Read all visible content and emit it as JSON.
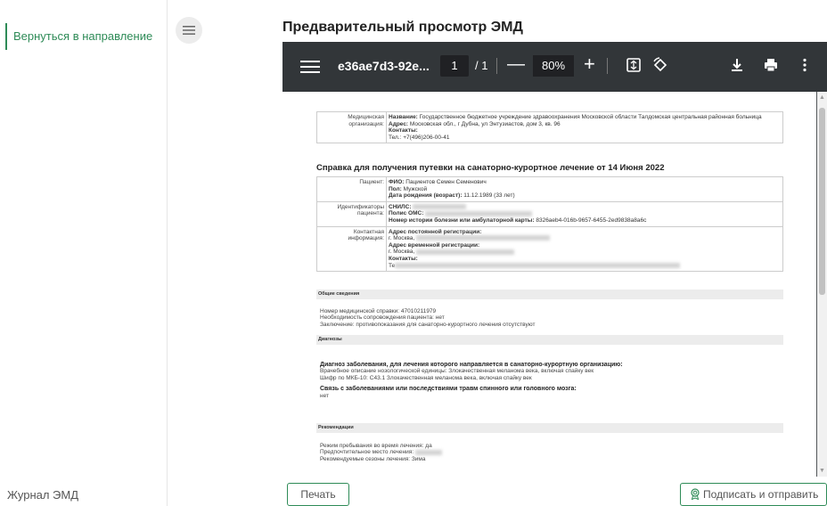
{
  "sidebar": {
    "back_label": "Вернуться в направление",
    "journal_label": "Журнал ЭМД"
  },
  "page": {
    "title": "Предварительный просмотр ЭМД"
  },
  "viewer": {
    "file_name": "e36ae7d3-92e...",
    "current_page": "1",
    "total_pages": "/ 1",
    "zoom": "80%"
  },
  "document": {
    "org": {
      "label": "Медицинская организация:",
      "name_label": "Название:",
      "name_value": "Государственное бюджетное учреждение здравоохранения Московской области Талдомская центральная районная больница",
      "address_label": "Адрес:",
      "address_value": "Московская обл., г Дубна, ул Энтузиастов, дом 3, кв. 96",
      "contacts_label": "Контакты:",
      "phone": "Тел.: +7(496)206-00-41"
    },
    "heading": "Справка для получения путевки на санаторно-курортное лечение от 14 Июня 2022",
    "patient": {
      "label": "Пациент:",
      "fio_label": "ФИО:",
      "fio_value": "Пациентов Семен Семенович",
      "sex_label": "Пол:",
      "sex_value": "Мужской",
      "dob_label": "Дата рождения (возраст):",
      "dob_value": "11.12.1989 (33 лет)"
    },
    "ids": {
      "label": "Идентификаторы пациента:",
      "snils_label": "СНИЛС:",
      "oms_label": "Полис ОМС:",
      "history_label": "Номер истории болезни или амбулаторной карты:",
      "history_value": "8326aeb4-016b-9657-6455-2ed9838a8a6c"
    },
    "contact": {
      "label": "Контактная информация:",
      "perm_label": "Адрес постоянной регистрации:",
      "perm_value": "г. Москва, ",
      "temp_label": "Адрес временной регистрации:",
      "temp_value": "г. Москва, ",
      "contacts_label": "Контакты:",
      "phone_prefix": "Те"
    },
    "general": {
      "title": "Общие сведения",
      "line1": "Номер медицинской справки: 47010211979",
      "line2": "Необходимость сопровождения пациента: нет",
      "line3": "Заключение: противопоказания для санаторно-курортного лечения отсутствуют"
    },
    "diagnoses": {
      "title": "Диагнозы",
      "head1": "Диагноз заболевания, для лечения которого направляется в санаторно-курортную организацию:",
      "line1": "Врачебное описание нозологической единицы: Злокачественная меланома века, включая спайку век",
      "line2": "Шифр по МКБ-10: C43.1 Злокачественная меланома века, включая спайку век",
      "head2": "Связь с заболеваниями или последствиями травм спинного или головного мозга:",
      "line3": "нет"
    },
    "recommendations": {
      "title": "Рекомендации",
      "line1": "Режим пребывания во время лечения: да",
      "line2": "Предпочтительное место лечения: ",
      "line3": "Рекомендуемые сезоны лечения: Зима"
    }
  },
  "actions": {
    "print_label": "Печать",
    "sign_label": "Подписать и отправить"
  },
  "colors": {
    "accent": "#2e8b57",
    "toolbar": "#323639",
    "viewer_bg": "#525659"
  }
}
